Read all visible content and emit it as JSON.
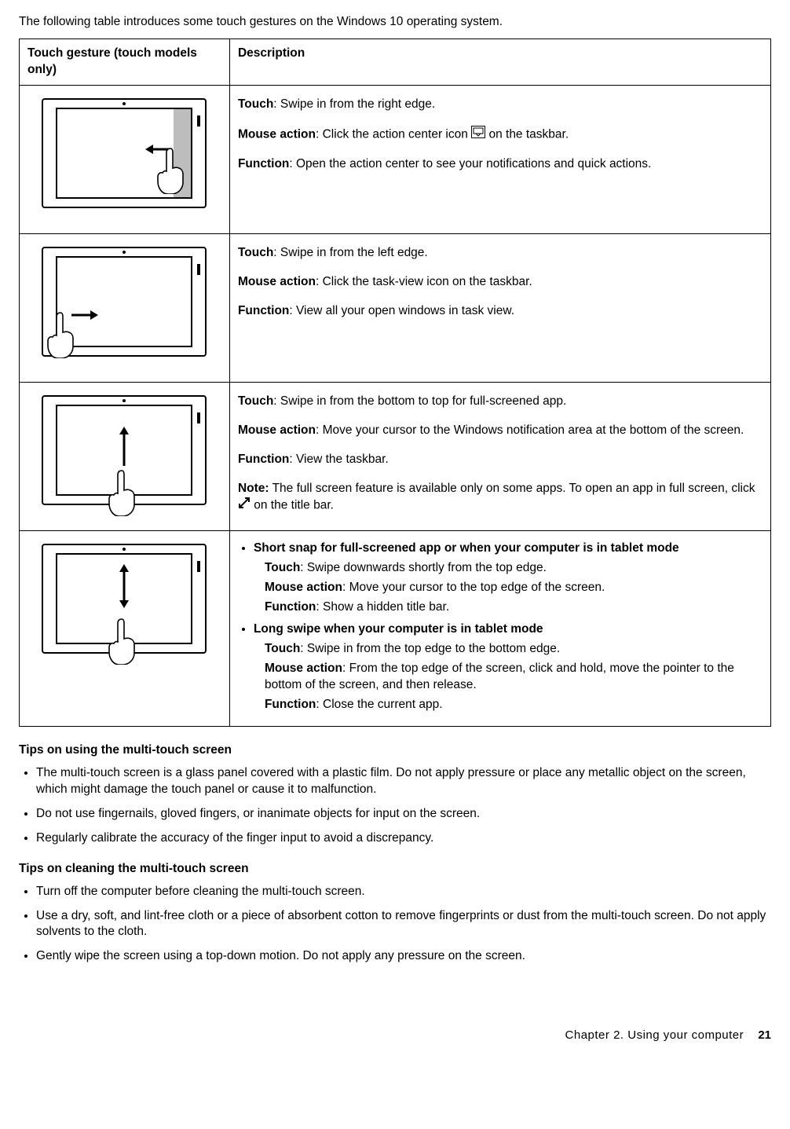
{
  "intro": "The following table introduces some touch gestures on the Windows 10 operating system.",
  "table": {
    "head_gesture": "Touch gesture (touch models only)",
    "head_desc": "Description",
    "rows": [
      {
        "touch_label": "Touch",
        "touch_text": ": Swipe in from the right edge.",
        "mouse_label": "Mouse action",
        "mouse_pre": ": Click the action center icon ",
        "mouse_post": " on the taskbar.",
        "func_label": "Function",
        "func_text": ": Open the action center to see your notifications and quick actions."
      },
      {
        "touch_label": "Touch",
        "touch_text": ": Swipe in from the left edge.",
        "mouse_label": "Mouse action",
        "mouse_text": ": Click the task-view icon on the taskbar.",
        "func_label": "Function",
        "func_text": ": View all your open windows in task view."
      },
      {
        "touch_label": "Touch",
        "touch_text": ": Swipe in from the bottom to top for full-screened app.",
        "mouse_label": "Mouse action",
        "mouse_text": ": Move your cursor to the Windows notification area at the bottom of the screen.",
        "func_label": "Function",
        "func_text": ": View the taskbar.",
        "note_label": "Note:",
        "note_pre": " The full screen feature is available only on some apps. To open an app in full screen, click ",
        "note_post": " on the title bar."
      },
      {
        "s1_head": "Short snap for full-screened app or when your computer is in tablet mode",
        "s1_touch_label": "Touch",
        "s1_touch": ": Swipe downwards shortly from the top edge.",
        "s1_mouse_label": "Mouse action",
        "s1_mouse": ": Move your cursor to the top edge of the screen.",
        "s1_func_label": "Function",
        "s1_func": ": Show a hidden title bar.",
        "s2_head": "Long swipe when your computer is in tablet mode",
        "s2_touch_label": "Touch",
        "s2_touch": ": Swipe in from the top edge to the bottom edge.",
        "s2_mouse_label": "Mouse action",
        "s2_mouse": ": From the top edge of the screen, click and hold, move the pointer to the bottom of the screen, and then release.",
        "s2_func_label": "Function",
        "s2_func": ": Close the current app."
      }
    ]
  },
  "tips_using_head": "Tips on using the multi-touch screen",
  "tips_using": [
    "The multi-touch screen is a glass panel covered with a plastic film. Do not apply pressure or place any metallic object on the screen, which might damage the touch panel or cause it to malfunction.",
    "Do not use fingernails, gloved fingers, or inanimate objects for input on the screen.",
    "Regularly calibrate the accuracy of the finger input to avoid a discrepancy."
  ],
  "tips_clean_head": "Tips on cleaning the multi-touch screen",
  "tips_clean": [
    "Turn off the computer before cleaning the multi-touch screen.",
    "Use a dry, soft, and lint-free cloth or a piece of absorbent cotton to remove fingerprints or dust from the multi-touch screen. Do not apply solvents to the cloth.",
    "Gently wipe the screen using a top-down motion. Do not apply any pressure on the screen."
  ],
  "footer_chapter": "Chapter 2. Using your computer",
  "footer_page": "21"
}
